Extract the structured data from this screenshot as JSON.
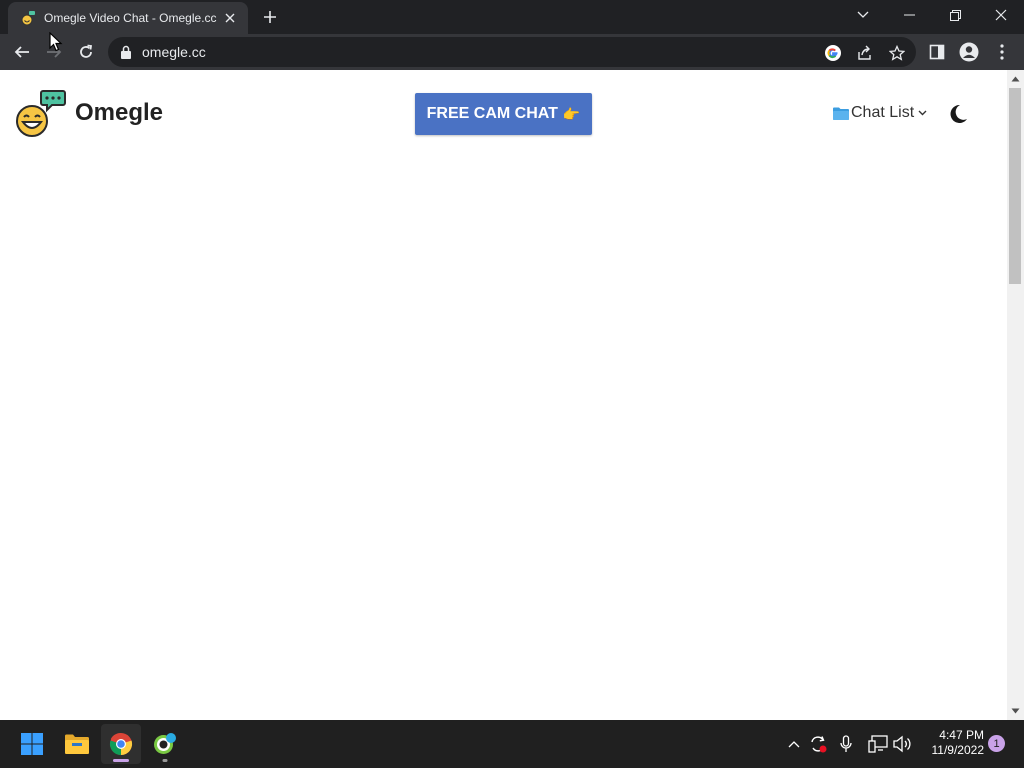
{
  "browser": {
    "tab_title": "Omegle Video Chat - Omegle.cc",
    "url": "omegle.cc"
  },
  "page": {
    "logo_text": "Omegle",
    "cam_button_label": "FREE CAM CHAT",
    "cam_button_emoji": "👉",
    "chat_list_label": "Chat List"
  },
  "taskbar": {
    "time": "4:47 PM",
    "date": "11/9/2022",
    "notification_count": "1"
  },
  "colors": {
    "cam_button": "#4a72c4",
    "chrome_dark": "#202124",
    "toolbar": "#35363a"
  }
}
